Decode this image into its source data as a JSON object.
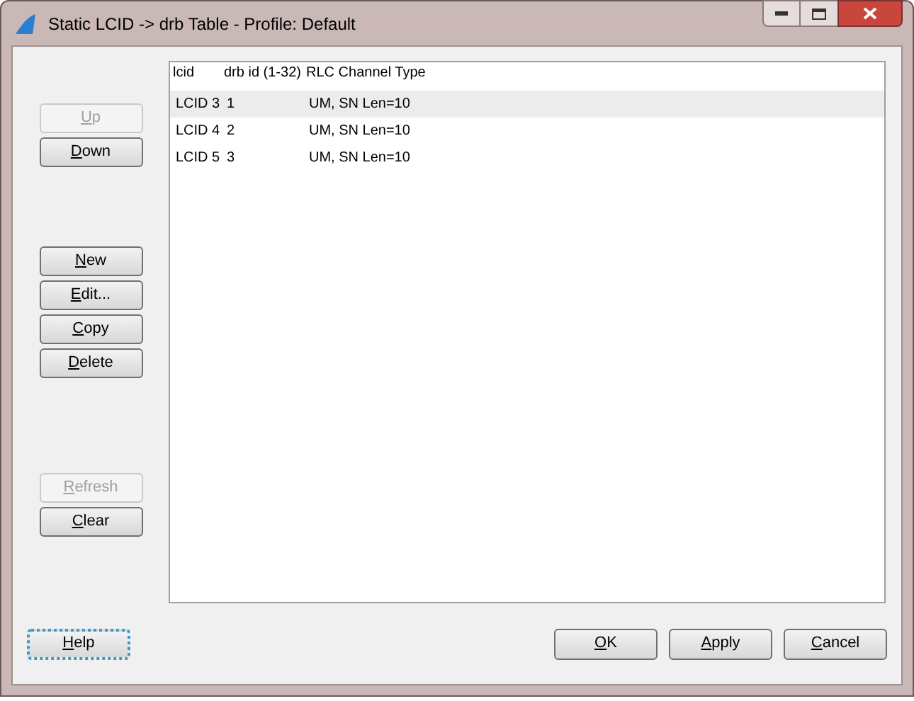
{
  "window": {
    "title": "Static LCID -> drb Table - Profile: Default"
  },
  "side_button_groups": [
    [
      {
        "label": "Up",
        "disabled": true
      },
      {
        "label": "Down",
        "disabled": false
      }
    ],
    [
      {
        "label": "New",
        "disabled": false
      },
      {
        "label": "Edit...",
        "disabled": false
      },
      {
        "label": "Copy",
        "disabled": false
      },
      {
        "label": "Delete",
        "disabled": false
      }
    ],
    [
      {
        "label": "Refresh",
        "disabled": true
      },
      {
        "label": "Clear",
        "disabled": false
      }
    ]
  ],
  "table": {
    "columns": [
      "lcid",
      "drb id (1-32)",
      "RLC Channel Type"
    ],
    "rows": [
      {
        "cells": [
          "LCID 3",
          "1",
          "UM, SN Len=10"
        ],
        "selected": true
      },
      {
        "cells": [
          "LCID 4",
          "2",
          "UM, SN Len=10"
        ],
        "selected": false
      },
      {
        "cells": [
          "LCID 5",
          "3",
          "UM, SN Len=10"
        ],
        "selected": false
      }
    ]
  },
  "bottom_buttons": [
    {
      "label": "Help",
      "focused": true
    },
    {
      "label": "OK",
      "focused": false
    },
    {
      "label": "Apply",
      "focused": false
    },
    {
      "label": "Cancel",
      "focused": false
    }
  ]
}
